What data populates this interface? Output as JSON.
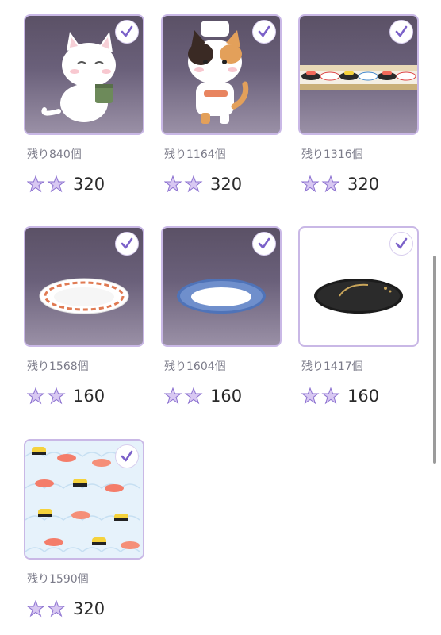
{
  "items": [
    {
      "remaining": "残り840個",
      "price": "320",
      "type": "cat-white"
    },
    {
      "remaining": "残り1164個",
      "price": "320",
      "type": "cat-chef"
    },
    {
      "remaining": "残り1316個",
      "price": "320",
      "type": "conveyor"
    },
    {
      "remaining": "残り1568個",
      "price": "160",
      "type": "plate-red"
    },
    {
      "remaining": "残り1604個",
      "price": "160",
      "type": "plate-blue"
    },
    {
      "remaining": "残り1417個",
      "price": "160",
      "type": "plate-black"
    },
    {
      "remaining": "残り1590個",
      "price": "320",
      "type": "sushi-pattern"
    }
  ],
  "colors": {
    "accent": "#7b61c9",
    "border": "#c9b8e6"
  }
}
